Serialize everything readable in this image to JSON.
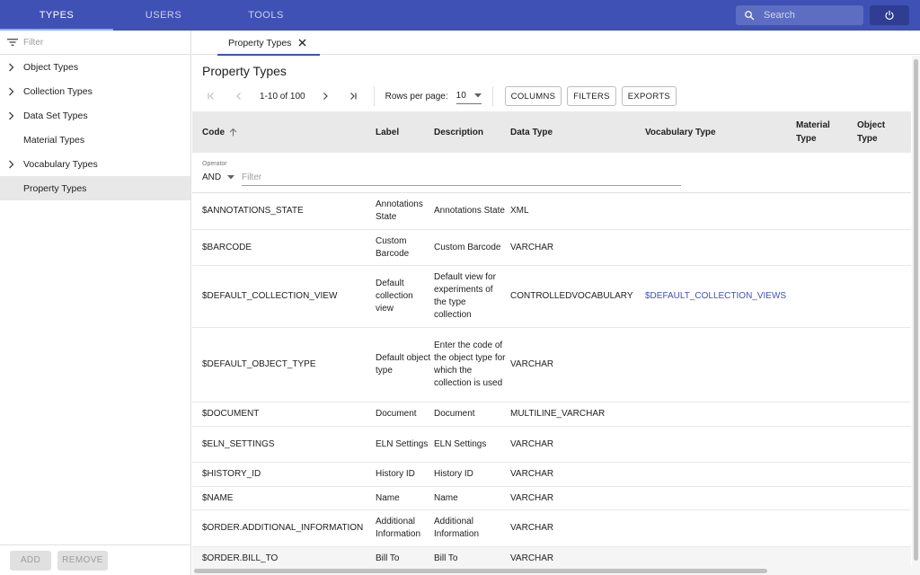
{
  "appbar": {
    "tabs": [
      {
        "label": "TYPES",
        "active": true
      },
      {
        "label": "USERS",
        "active": false
      },
      {
        "label": "TOOLS",
        "active": false
      }
    ],
    "search_placeholder": "Search"
  },
  "sidebar": {
    "filter_placeholder": "Filter",
    "items": [
      {
        "label": "Object Types",
        "expandable": true
      },
      {
        "label": "Collection Types",
        "expandable": true
      },
      {
        "label": "Data Set Types",
        "expandable": true
      },
      {
        "label": "Material Types",
        "expandable": false
      },
      {
        "label": "Vocabulary Types",
        "expandable": true
      },
      {
        "label": "Property Types",
        "expandable": false,
        "selected": true
      }
    ],
    "add_label": "ADD",
    "remove_label": "REMOVE"
  },
  "content_tab": {
    "label": "Property Types"
  },
  "page": {
    "title": "Property Types",
    "pagination": {
      "range": "1-10 of 100",
      "rows_label": "Rows per page:",
      "rows_value": "10"
    },
    "buttons": {
      "columns": "COLUMNS",
      "filters": "FILTERS",
      "exports": "EXPORTS"
    }
  },
  "table": {
    "headers": {
      "code": "Code",
      "label": "Label",
      "description": "Description",
      "data_type": "Data Type",
      "vocabulary_type": "Vocabulary Type",
      "material_type": "Material Type",
      "object_type": "Object Type"
    },
    "filter": {
      "operator_label": "Operator",
      "operator_value": "AND",
      "placeholder": "Filter"
    },
    "rows": [
      {
        "code": "$ANNOTATIONS_STATE",
        "label": "Annotations State",
        "description": "Annotations State",
        "data_type": "XML",
        "vocabulary": ""
      },
      {
        "code": "$BARCODE",
        "label": "Custom Barcode",
        "description": "Custom Barcode",
        "data_type": "VARCHAR",
        "vocabulary": ""
      },
      {
        "code": "$DEFAULT_COLLECTION_VIEW",
        "label": "Default collection view",
        "description": "Default view for experiments of the type collection",
        "data_type": "CONTROLLEDVOCABULARY",
        "vocabulary": "$DEFAULT_COLLECTION_VIEWS"
      },
      {
        "code": "$DEFAULT_OBJECT_TYPE",
        "label": "Default object type",
        "description": "Enter the code of the object type for which the collection is used",
        "data_type": "VARCHAR",
        "vocabulary": ""
      },
      {
        "code": "$DOCUMENT",
        "label": "Document",
        "description": "Document",
        "data_type": "MULTILINE_VARCHAR",
        "vocabulary": ""
      },
      {
        "code": "$ELN_SETTINGS",
        "label": "ELN Settings",
        "description": "ELN Settings",
        "data_type": "VARCHAR",
        "vocabulary": ""
      },
      {
        "code": "$HISTORY_ID",
        "label": "History ID",
        "description": "History ID",
        "data_type": "VARCHAR",
        "vocabulary": ""
      },
      {
        "code": "$NAME",
        "label": "Name",
        "description": "Name",
        "data_type": "VARCHAR",
        "vocabulary": ""
      },
      {
        "code": "$ORDER.ADDITIONAL_INFORMATION",
        "label": "Additional Information",
        "description": "Additional Information",
        "data_type": "VARCHAR",
        "vocabulary": ""
      },
      {
        "code": "$ORDER.BILL_TO",
        "label": "Bill To",
        "description": "Bill To",
        "data_type": "VARCHAR",
        "vocabulary": ""
      }
    ]
  }
}
